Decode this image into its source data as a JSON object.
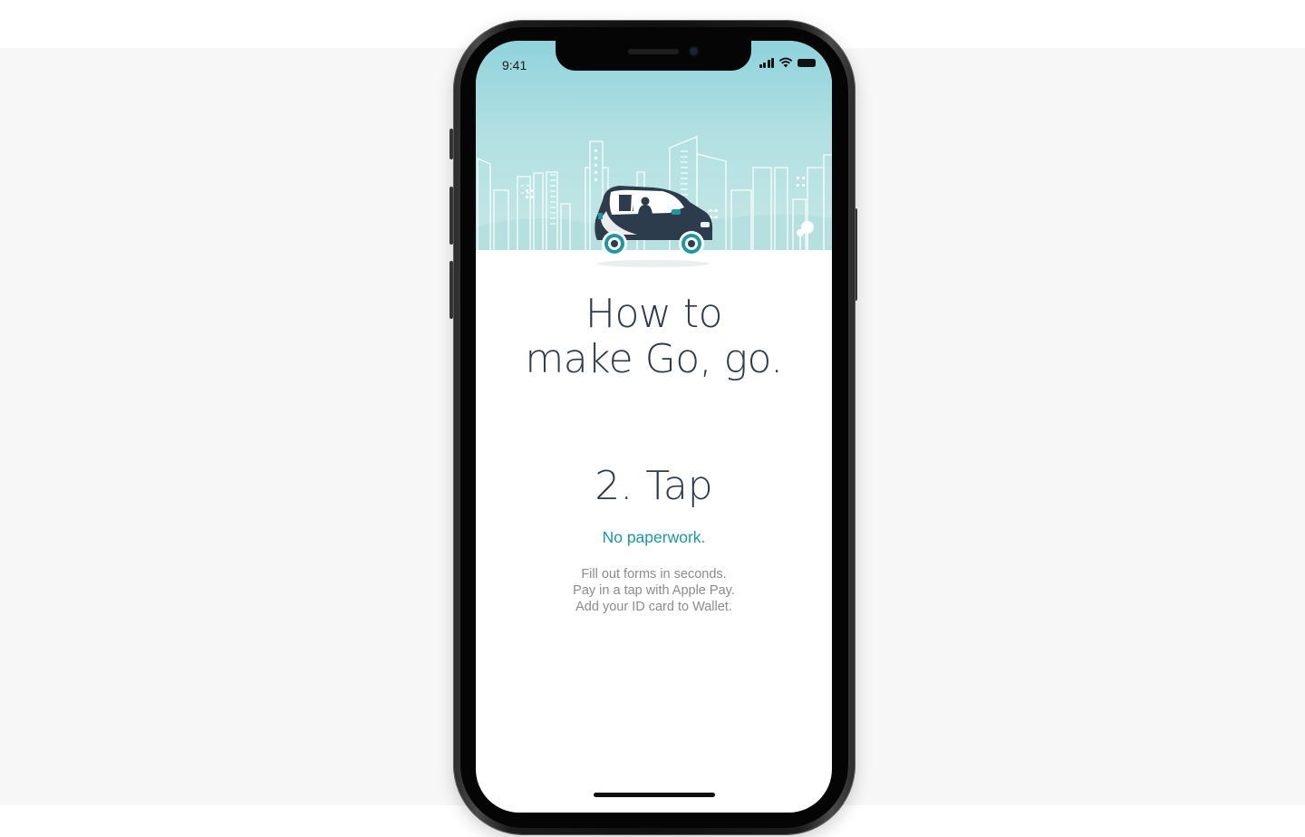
{
  "status_bar": {
    "time": "9:41"
  },
  "onboarding": {
    "headline_line1": "How to",
    "headline_line2": "make Go, go.",
    "step_title": "2. Tap",
    "step_subtitle": "No paperwork.",
    "step_body": [
      "Fill out forms in seconds.",
      "Pay in a tap with Apple Pay.",
      "Add your ID card to Wallet."
    ]
  },
  "colors": {
    "accent": "#1c97a4",
    "headline": "#2c3a4b",
    "body_text": "#8c8c8c",
    "sky": "#b2e0e2",
    "car_body": "#2d3c4d"
  },
  "icons": [
    "cellular-signal-icon",
    "wifi-icon",
    "battery-icon"
  ]
}
